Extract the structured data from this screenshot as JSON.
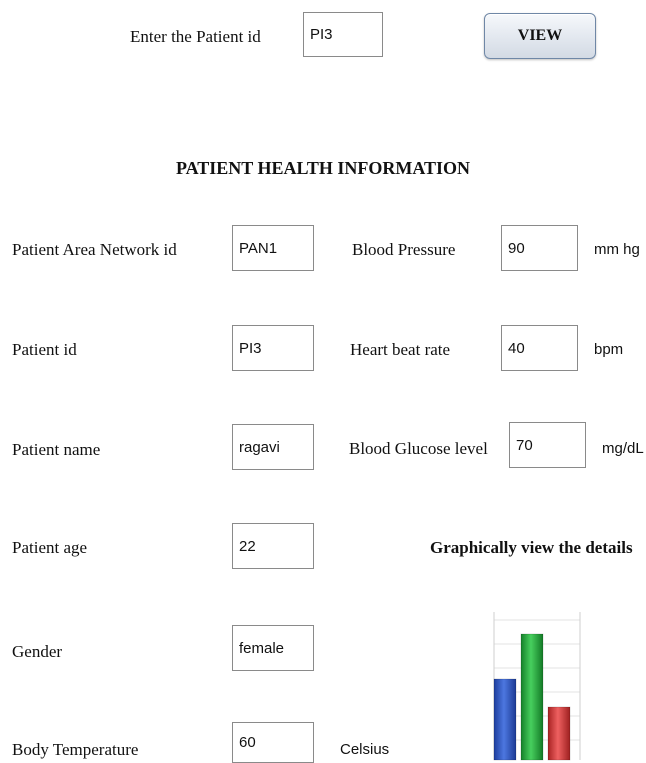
{
  "search": {
    "label": "Enter the Patient id",
    "value": "PI3",
    "button_label": "VIEW"
  },
  "page_title": "PATIENT HEALTH INFORMATION",
  "left_fields": {
    "pan_id": {
      "label": "Patient Area Network  id",
      "value": "PAN1"
    },
    "patient_id": {
      "label": "Patient id",
      "value": "PI3"
    },
    "patient_name": {
      "label": "Patient name",
      "value": "ragavi"
    },
    "patient_age": {
      "label": "Patient age",
      "value": "22"
    },
    "gender": {
      "label": "Gender",
      "value": "female"
    },
    "body_temperature": {
      "label": "Body Temperature",
      "value": "60",
      "unit": "Celsius"
    }
  },
  "right_fields": {
    "blood_pressure": {
      "label": "Blood Pressure",
      "value": "90",
      "unit": "mm hg"
    },
    "heart_rate": {
      "label": "Heart beat rate",
      "value": "40",
      "unit": "bpm"
    },
    "blood_glucose": {
      "label": "Blood Glucose level",
      "value": "70",
      "unit": "mg/dL"
    }
  },
  "graph": {
    "label": "Graphically view the details",
    "icon": "bar-chart-icon",
    "bar_levels": [
      0.55,
      0.85,
      0.36
    ],
    "colors": {
      "blue": "#2f57c6",
      "green": "#23a83a",
      "red": "#d33a3a"
    }
  },
  "colors": {
    "button_border": "#6f87a6",
    "field_border": "#8a8a8a"
  }
}
